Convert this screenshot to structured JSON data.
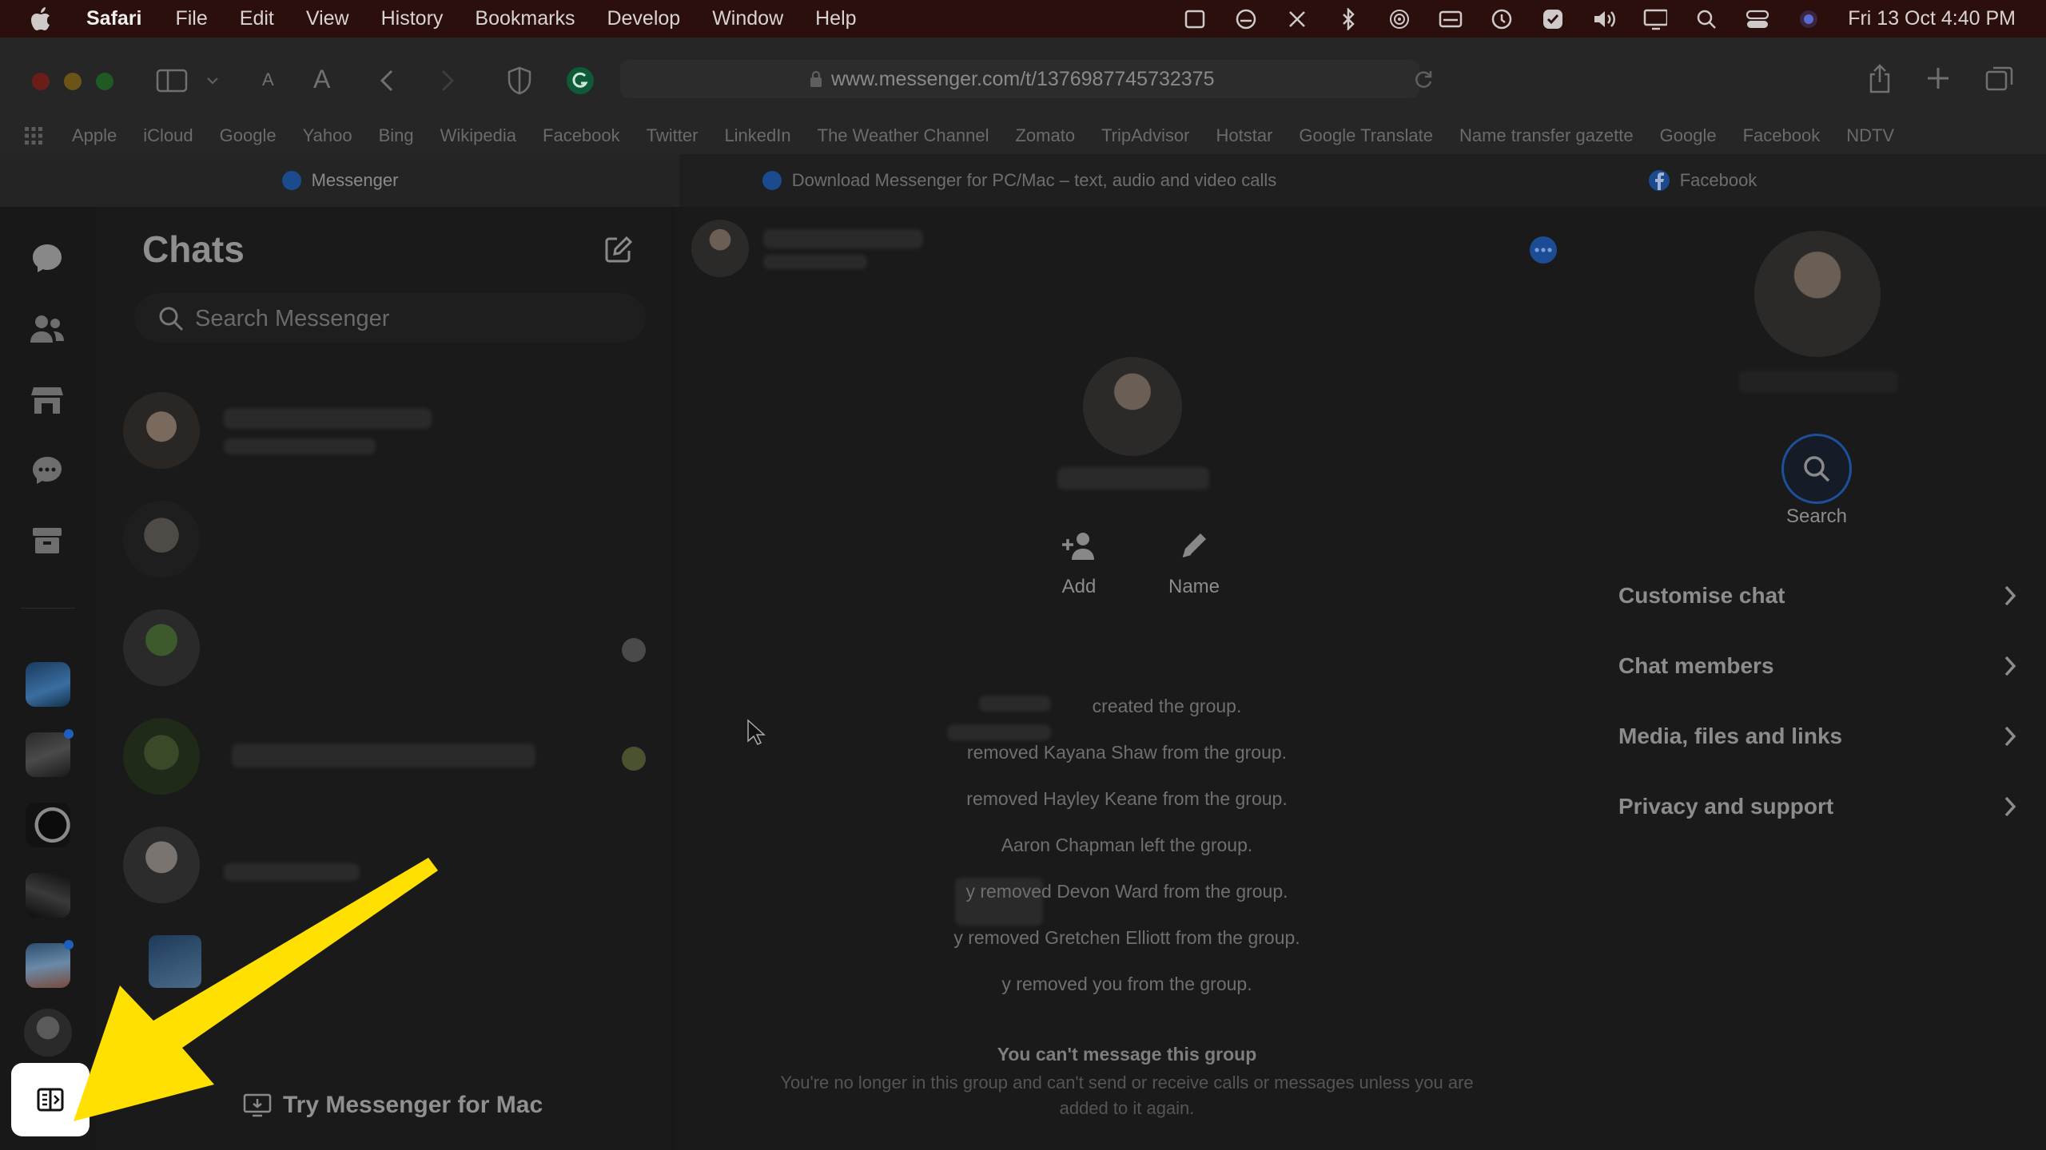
{
  "menubar": {
    "app": "Safari",
    "items": [
      "File",
      "Edit",
      "View",
      "History",
      "Bookmarks",
      "Develop",
      "Window",
      "Help"
    ],
    "datetime": "Fri 13 Oct  4:40 PM"
  },
  "browser": {
    "url": "www.messenger.com/t/1376987745732375",
    "bookmarks": [
      "Apple",
      "iCloud",
      "Google",
      "Yahoo",
      "Bing",
      "Wikipedia",
      "Facebook",
      "Twitter",
      "LinkedIn",
      "The Weather Channel",
      "Zomato",
      "TripAdvisor",
      "Hotstar",
      "Google Translate",
      "Name transfer gazette",
      "Google",
      "Facebook",
      "NDTV"
    ],
    "tabs": [
      {
        "label": "Messenger",
        "icon": "messenger-icon"
      },
      {
        "label": "Download Messenger for PC/Mac – text, audio and video calls",
        "icon": "messenger-icon"
      },
      {
        "label": "Facebook",
        "icon": "facebook-icon"
      }
    ]
  },
  "chats": {
    "title": "Chats",
    "search_placeholder": "Search Messenger",
    "try_mac": "Try Messenger for Mac"
  },
  "conversation": {
    "actions": [
      {
        "label": "Add",
        "icon": "add-person-icon"
      },
      {
        "label": "Name",
        "icon": "pencil-icon"
      }
    ],
    "events": [
      "created the group.",
      "removed Kayana Shaw from the group.",
      "removed Hayley Keane from the group.",
      "Aaron Chapman left the group.",
      "y removed Devon Ward from the group.",
      "y removed Gretchen Elliott from the group.",
      "y removed you from the group."
    ],
    "notice_title": "You can't message this group",
    "notice_body_1": "You're no longer in this group and can't send or receive calls or messages unless you are",
    "notice_body_2": "added to it again."
  },
  "info_panel": {
    "search_label": "Search",
    "rows": [
      "Customise chat",
      "Chat members",
      "Media, files and links",
      "Privacy and support"
    ]
  },
  "colors": {
    "menubar_bg": "#2a0f0c",
    "highlight_arrow": "#ffe000",
    "messenger_blue": "#1f5fbf"
  }
}
